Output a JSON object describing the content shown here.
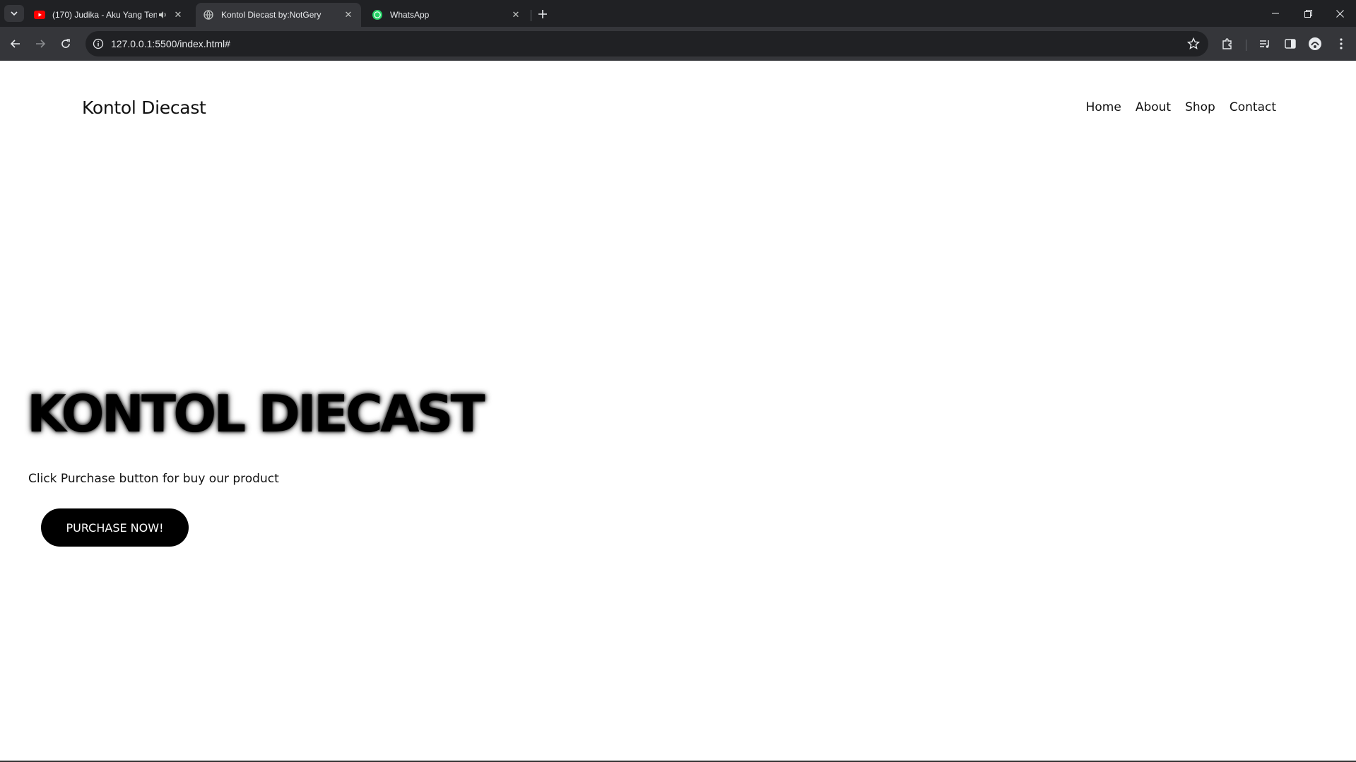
{
  "browser": {
    "tabs": [
      {
        "title": "(170) Judika - Aku Yang Ten",
        "favicon": "youtube-icon",
        "audio": true
      },
      {
        "title": "Kontol Diecast by:NotGery",
        "favicon": "globe-icon",
        "active": true
      },
      {
        "title": "WhatsApp",
        "favicon": "whatsapp-icon"
      }
    ],
    "url": "127.0.0.1:5500/index.html#"
  },
  "site": {
    "brand": "Kontol Diecast",
    "nav": [
      "Home",
      "About",
      "Shop",
      "Contact"
    ]
  },
  "hero": {
    "title": "KONTOL DIECAST",
    "subtitle": "Click Purchase button for buy our product",
    "button": "PURCHASE NOW!"
  }
}
